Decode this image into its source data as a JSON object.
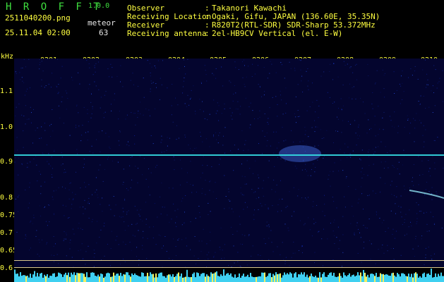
{
  "app": {
    "title": "H R O F F T",
    "version": "1.0.0"
  },
  "file": {
    "name": "2511040200.png",
    "datetime": "25.11.04 02:00"
  },
  "meteor": {
    "label": "meteor",
    "count": "63"
  },
  "info": [
    {
      "key": "Observer",
      "value": "Takanori Kawachi"
    },
    {
      "key": "Receiving Location",
      "value": "Ogaki, Gifu, JAPAN (136.60E, 35.35N)"
    },
    {
      "key": "Receiver",
      "value": "R820T2(RTL-SDR) SDR-Sharp 53.372MHz"
    },
    {
      "key": "Receiving antenna",
      "value": "2el-HB9CV Vertical (el. E-W)"
    }
  ],
  "axis": {
    "unit": "kHz",
    "yticks": [
      "1.1",
      "1.0",
      "0.9",
      "0.8",
      "0.75",
      "0.7",
      "0.65",
      "0.6"
    ],
    "xticks": [
      "0201",
      "0202",
      "0203",
      "0204",
      "0205",
      "0206",
      "0207",
      "0208",
      "0209",
      "0210"
    ]
  },
  "colors": {
    "label": "#ffff40",
    "title": "#3fe03f",
    "carrier": "#35e0e6",
    "background": "#04052e"
  }
}
